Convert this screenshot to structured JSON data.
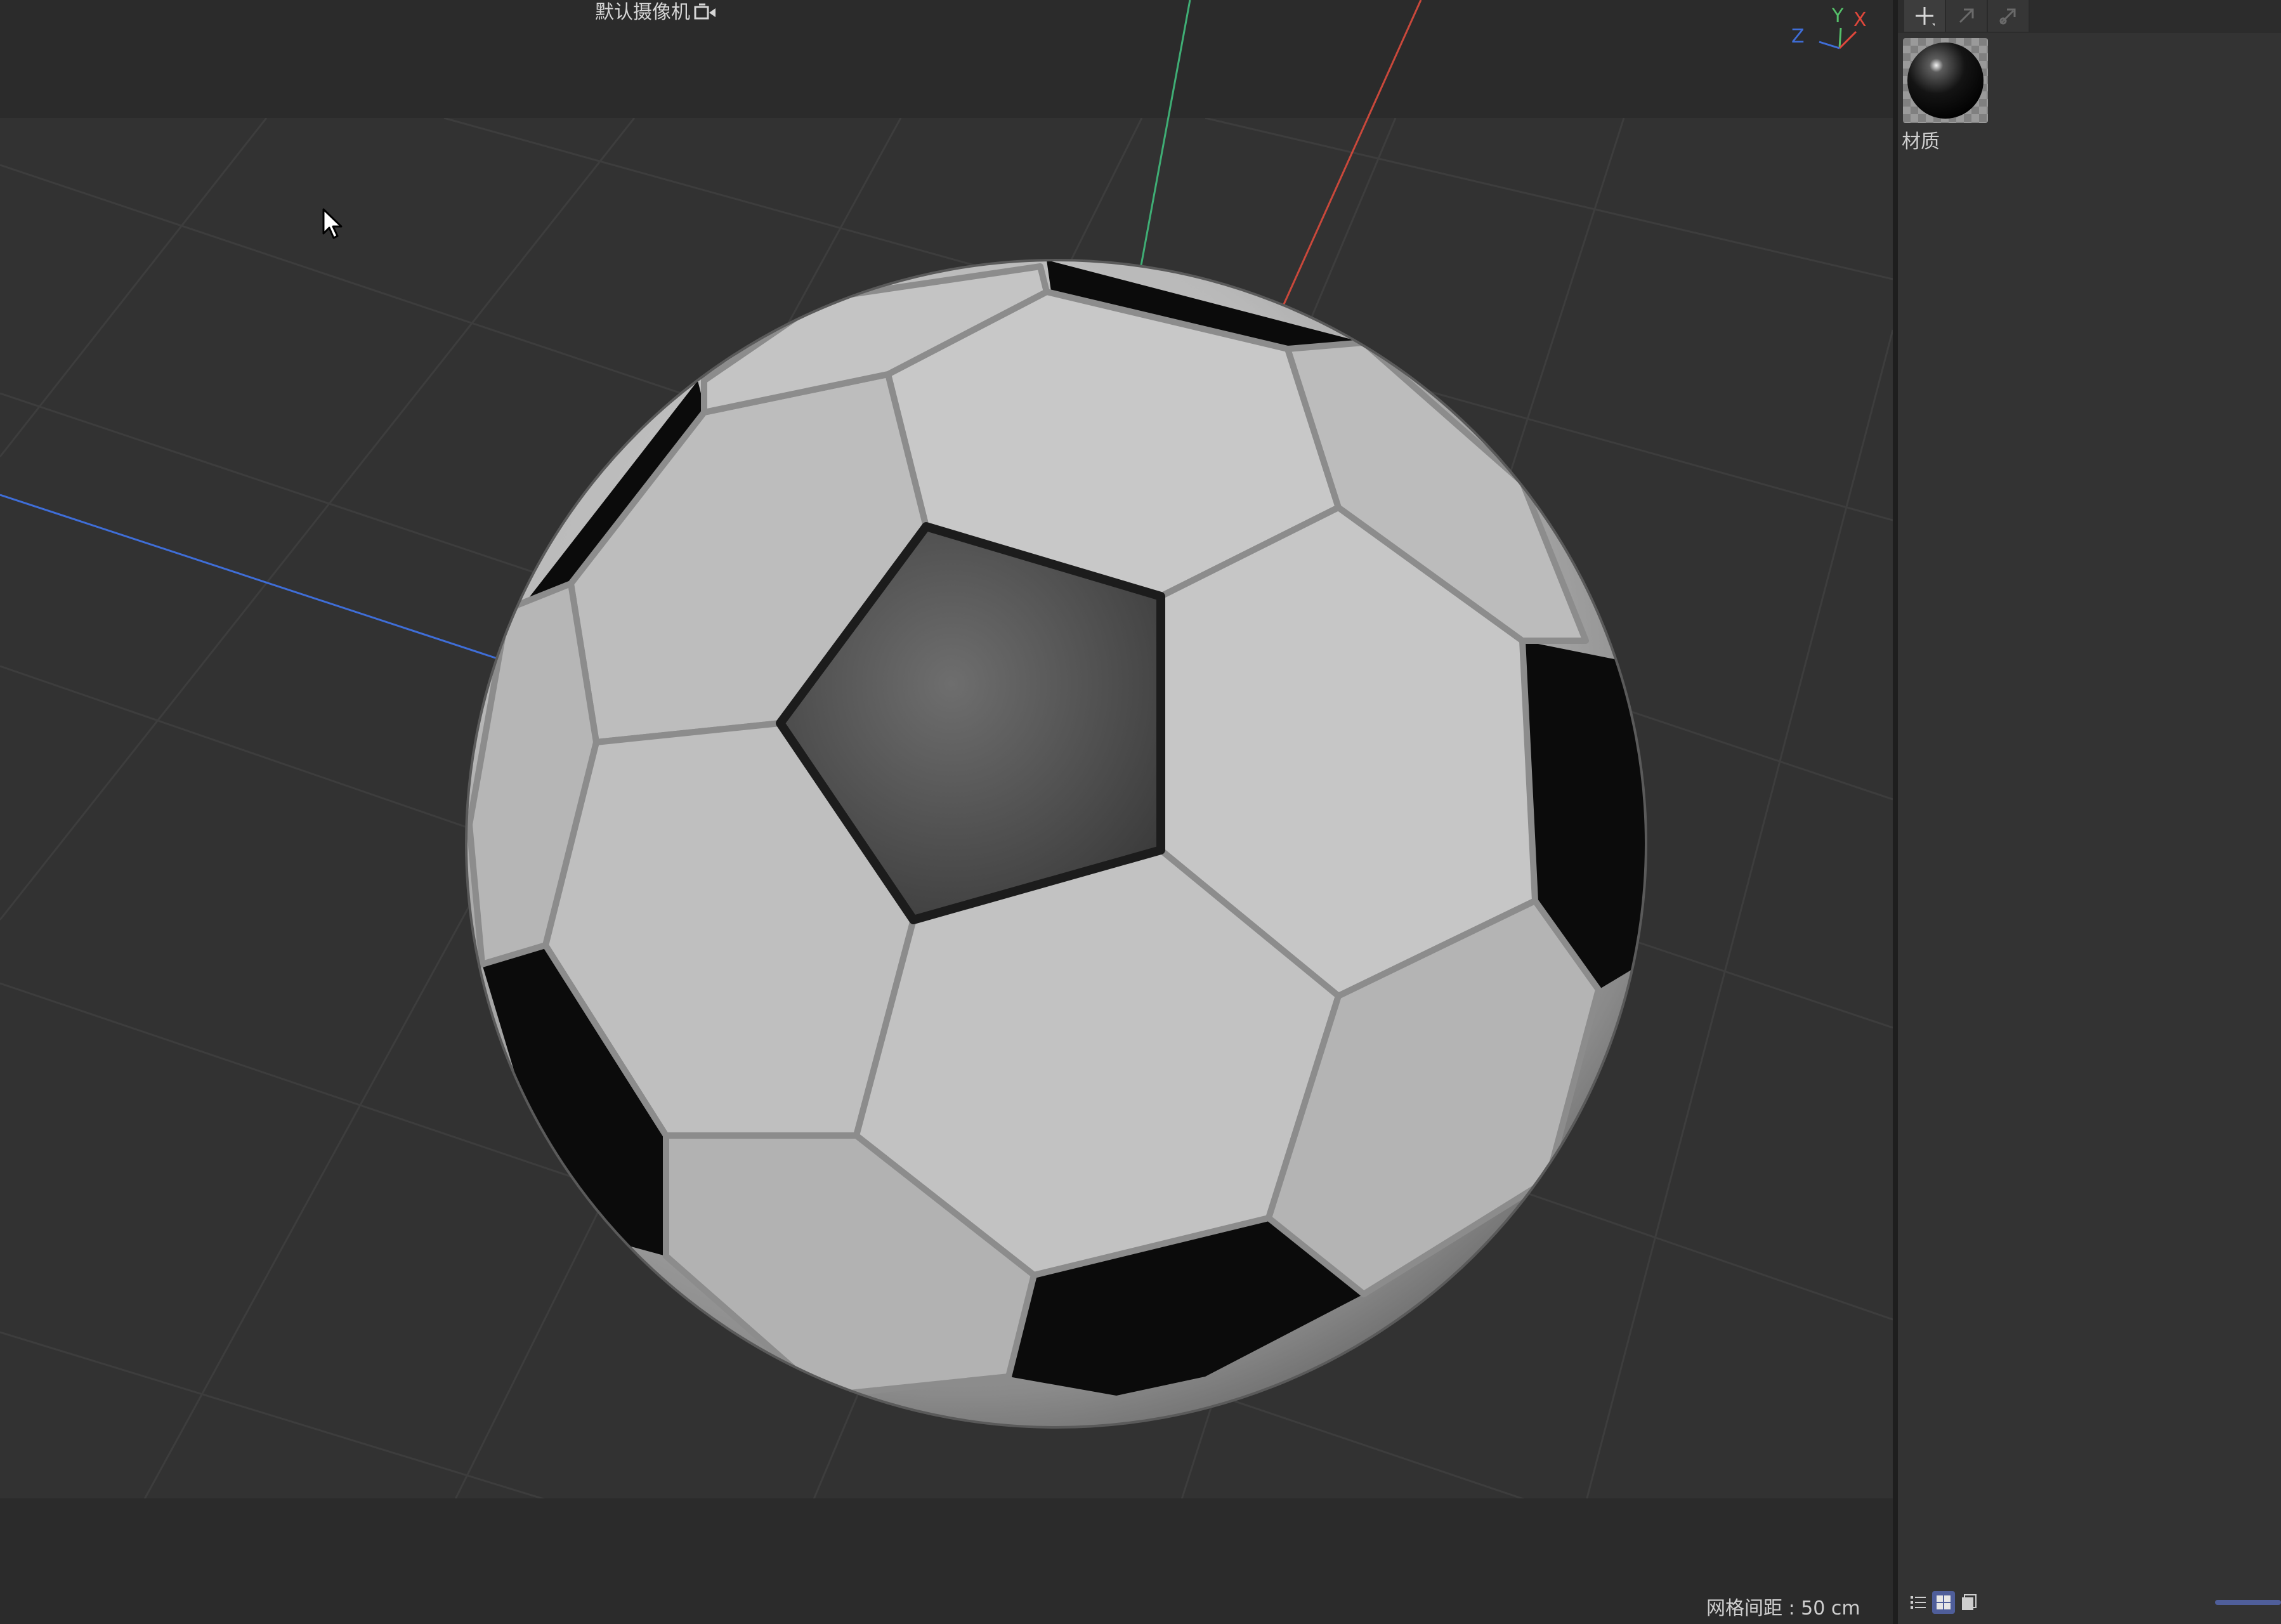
{
  "viewport": {
    "camera_label": "默认摄像机",
    "grid_spacing": "网格间距 : 50 cm",
    "axes": {
      "x": "X",
      "y": "Y",
      "z": "Z"
    },
    "icons": {
      "camera": "camera-icon",
      "cursor": "mouse-pointer-icon"
    },
    "colors": {
      "x_axis": "#e0473b",
      "y_axis": "#55c06a",
      "z_axis": "#3f6ed8"
    }
  },
  "material_panel": {
    "toolbar": {
      "add_tooltip": "add-icon",
      "buttons": [
        "add-icon",
        "pointer-arrow-icon",
        "arrow-link-icon"
      ]
    },
    "materials": [
      {
        "name": "材质"
      }
    ],
    "view_modes": [
      "list-view-icon",
      "grid-view-icon",
      "single-view-icon"
    ],
    "active_view": "grid-view-icon",
    "accent": "#4f5e9a"
  }
}
